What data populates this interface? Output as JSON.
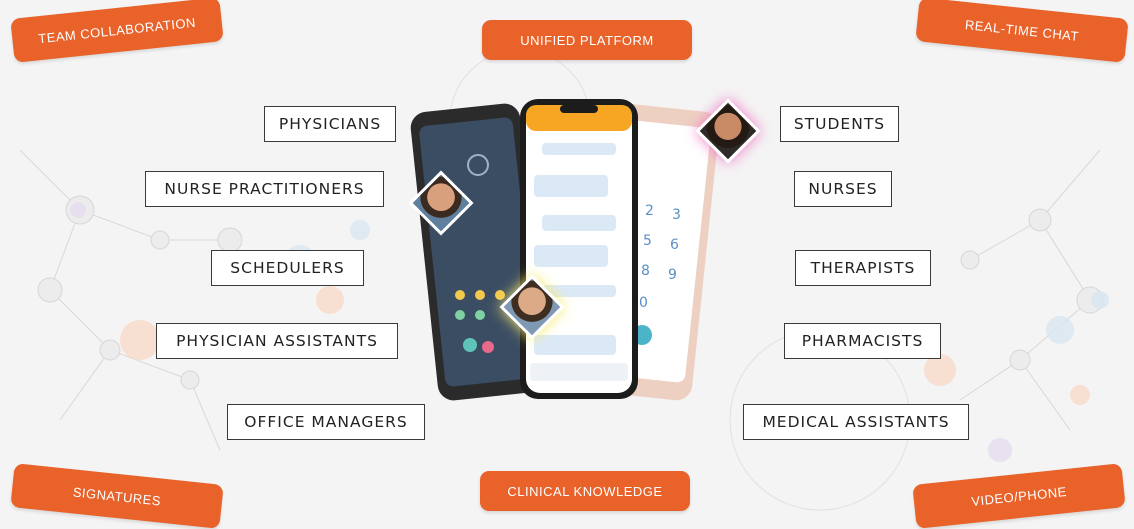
{
  "features": {
    "team_collaboration": "TEAM COLLABORATION",
    "unified_platform": "UNIFIED PLATFORM",
    "real_time_chat": "REAL-TIME CHAT",
    "signatures": "SIGNATURES",
    "clinical_knowledge": "CLINICAL KNOWLEDGE",
    "video_phone": "VIDEO/PHONE"
  },
  "roles_left": {
    "physicians": "PHYSICIANS",
    "nurse_practitioners": "NURSE PRACTITIONERS",
    "schedulers": "SCHEDULERS",
    "physician_assistants": "PHYSICIAN ASSISTANTS",
    "office_managers": "OFFICE MANAGERS"
  },
  "roles_right": {
    "students": "STUDENTS",
    "nurses": "NURSES",
    "therapists": "THERAPISTS",
    "pharmacists": "PHARMACISTS",
    "medical_assistants": "MEDICAL ASSISTANTS"
  },
  "colors": {
    "accent": "#e8622a",
    "background": "#f4f4f4",
    "border": "#3a3a3a"
  },
  "icons": [
    "phone-mockup-left",
    "phone-mockup-center",
    "phone-mockup-right",
    "avatar-icon"
  ]
}
